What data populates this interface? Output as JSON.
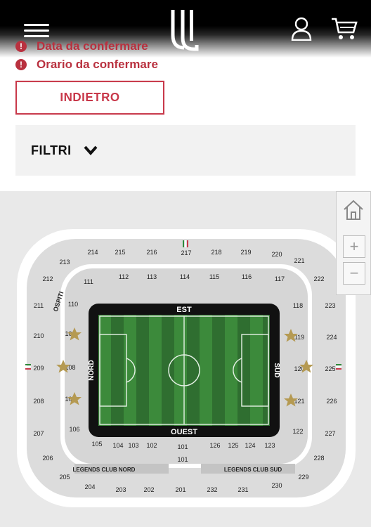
{
  "header": {
    "menu_icon": "hamburger-icon",
    "logo_icon": "juventus-logo",
    "user_icon": "user-icon",
    "cart_icon": "cart-icon"
  },
  "notices": [
    {
      "icon": "alert-icon",
      "text": "Data da confermare"
    },
    {
      "icon": "alert-icon",
      "text": "Orario da confermare"
    }
  ],
  "back_button": {
    "label": "INDIETRO"
  },
  "filters": {
    "label": "FILTRI",
    "icon": "chevron-down-icon"
  },
  "map_controls": {
    "home_icon": "home-icon",
    "zoom_in": "+",
    "zoom_out": "−"
  },
  "stadium": {
    "pitch_labels": {
      "north": "EST",
      "south": "OUEST",
      "left": "NORD",
      "right": "SUD"
    },
    "legends_labels": [
      "LEGENDS CLUB NORD",
      "LEGENDS CLUB SUD"
    ],
    "sector_101_lower": "101",
    "away_label": "OSPITI",
    "sectors_upper": [
      "214",
      "215",
      "216",
      "217",
      "218",
      "219",
      "220",
      "221",
      "222",
      "223",
      "224",
      "225",
      "226",
      "227",
      "228",
      "229",
      "230",
      "231",
      "232",
      "201",
      "202",
      "203",
      "204",
      "205",
      "206",
      "207",
      "208",
      "209",
      "210",
      "211",
      "212",
      "213"
    ],
    "sectors_lower": [
      "111",
      "112",
      "113",
      "114",
      "115",
      "116",
      "117",
      "118",
      "119",
      "120",
      "121",
      "122",
      "123",
      "124",
      "125",
      "126",
      "101",
      "102",
      "103",
      "104",
      "105",
      "106",
      "107",
      "108",
      "109",
      "110"
    ]
  },
  "colors": {
    "accent": "#c8384a",
    "notice": "#b9313f",
    "pitch_dark": "#2f6e30",
    "pitch_light": "#3f8c3c",
    "sector": "#cfcfcf",
    "filters_bg": "#f2f2f2"
  }
}
